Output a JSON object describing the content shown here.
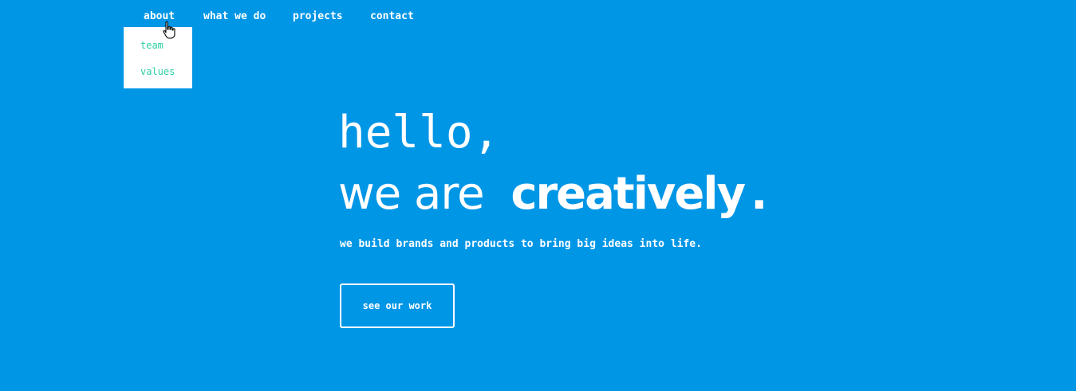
{
  "nav": {
    "items": [
      {
        "label": "about"
      },
      {
        "label": "what we do"
      },
      {
        "label": "projects"
      },
      {
        "label": "contact"
      }
    ],
    "dropdown": {
      "items": [
        {
          "label": "team"
        },
        {
          "label": "values"
        }
      ]
    }
  },
  "hero": {
    "line1": "hello,",
    "line2_plain": "we are",
    "line2_strong": "creatively",
    "line2_end": "."
  },
  "tagline": "we build brands and products to bring big ideas into life.",
  "cta": {
    "label": "see our work"
  },
  "colors": {
    "background": "#0096e6",
    "text": "#ffffff",
    "dropdown_link": "#2ccfa3",
    "dropdown_bg": "#ffffff"
  },
  "icons": {
    "cursor": "hand-pointer-icon"
  }
}
